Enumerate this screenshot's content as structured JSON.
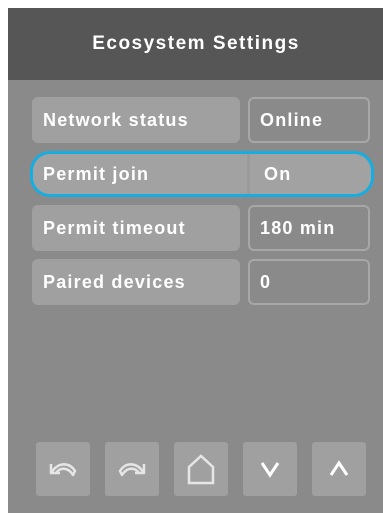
{
  "header": {
    "title": "Ecosystem Settings"
  },
  "settings": {
    "rows": [
      {
        "label": "Network status",
        "value": "Online",
        "selected": false
      },
      {
        "label": "Permit join",
        "value": "On",
        "selected": true
      },
      {
        "label": "Permit timeout",
        "value": "180 min",
        "selected": false
      },
      {
        "label": "Paired devices",
        "value": "0",
        "selected": false
      }
    ]
  },
  "nav_buttons": [
    {
      "icon": "undo-icon"
    },
    {
      "icon": "redo-icon"
    },
    {
      "icon": "home-icon"
    },
    {
      "icon": "chevron-down-icon"
    },
    {
      "icon": "chevron-up-icon"
    }
  ],
  "colors": {
    "screen_background": "#8a8a8a",
    "header_background": "#565656",
    "label_background": "#a0a0a0",
    "selection_highlight": "#14aee2",
    "text": "#ffffff"
  }
}
